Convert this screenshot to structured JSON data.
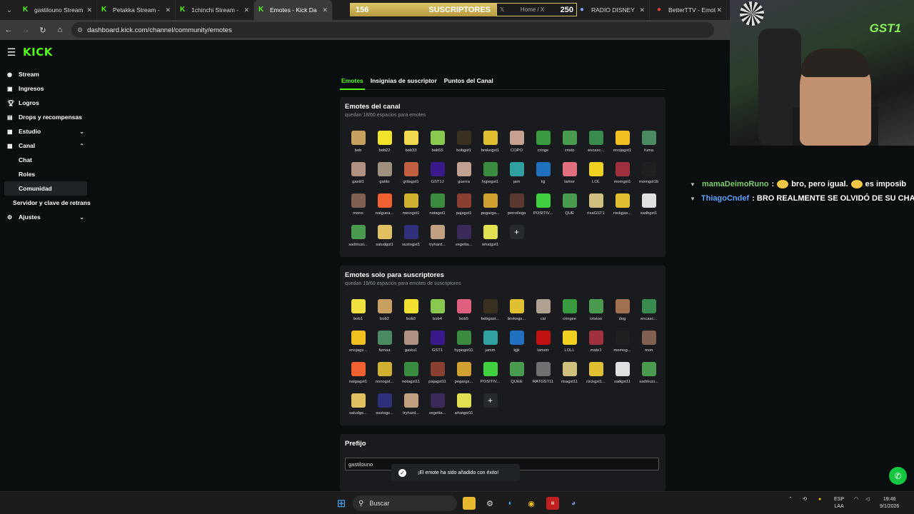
{
  "browser": {
    "tabs": [
      {
        "title": "gastilouno Stream",
        "icon": "kick-icon",
        "active": false
      },
      {
        "title": "Petakka Stream -",
        "icon": "kick-icon",
        "active": false
      },
      {
        "title": "1chinchi Stream -",
        "icon": "kick-icon",
        "active": false
      },
      {
        "title": "Emotes - Kick Da",
        "icon": "kick-icon",
        "active": true
      }
    ],
    "right_tabs": [
      {
        "title": "RADIO DISNEY",
        "icon": "radio-icon"
      },
      {
        "title": "BetterTTV - Emot",
        "icon": "bttv-icon"
      }
    ],
    "url": "dashboard.kick.com/channel/community/emotes"
  },
  "overlay_bar": {
    "left_count": "156",
    "label": "SUSCRIPTORES",
    "home_label": "Home / X",
    "right_count": "250"
  },
  "header": {
    "logo": "KICK"
  },
  "sidebar": {
    "items": [
      {
        "label": "Stream",
        "icon": "broadcast-icon"
      },
      {
        "label": "Ingresos",
        "icon": "wallet-icon"
      },
      {
        "label": "Logros",
        "icon": "trophy-icon"
      },
      {
        "label": "Drops y recompensas",
        "icon": "gift-icon"
      },
      {
        "label": "Estudio",
        "icon": "studio-icon"
      },
      {
        "label": "Canal",
        "icon": "channel-icon"
      },
      {
        "label": "Chat"
      },
      {
        "label": "Roles"
      },
      {
        "label": "Comunidad"
      },
      {
        "label": "Servidor y clave de retrans"
      },
      {
        "label": "Ajustes",
        "icon": "gear-icon"
      }
    ]
  },
  "main_tabs": [
    "Emotes",
    "Insignias de suscriptor",
    "Puntos del Canal"
  ],
  "channel_emotes": {
    "title": "Emotes del canal",
    "subtitle": "quedan 18/60 espacios para emotes",
    "emotes": [
      {
        "name": "bob",
        "color": "#c8a060"
      },
      {
        "name": "bob22",
        "color": "#f2e22a"
      },
      {
        "name": "bob33",
        "color": "#f0d850"
      },
      {
        "name": "bob55",
        "color": "#8ac850"
      },
      {
        "name": "bobgst1",
        "color": "#3a3020"
      },
      {
        "name": "brokegst1",
        "color": "#e0c030"
      },
      {
        "name": "COPO",
        "color": "#c8a090"
      },
      {
        "name": "cringe",
        "color": "#3a9a40"
      },
      {
        "name": "cristo",
        "color": "#4a9a50"
      },
      {
        "name": "encasc...",
        "color": "#3a8a50"
      },
      {
        "name": "enojagst1",
        "color": "#f0c020"
      },
      {
        "name": "fuma",
        "color": "#4a8a60"
      },
      {
        "name": "gastil1",
        "color": "#b09080"
      },
      {
        "name": "gatito",
        "color": "#a09080"
      },
      {
        "name": "gritagst1",
        "color": "#c06040"
      },
      {
        "name": "GST1J",
        "color": "#3a1a8a"
      },
      {
        "name": "guerra",
        "color": "#c0a090"
      },
      {
        "name": "hypegst1",
        "color": "#3a8a40"
      },
      {
        "name": "jam",
        "color": "#30a0a0"
      },
      {
        "name": "kjj",
        "color": "#2070c0"
      },
      {
        "name": "lamer",
        "color": "#e07080"
      },
      {
        "name": "LOL",
        "color": "#f0d020"
      },
      {
        "name": "momgst1",
        "color": "#a03040"
      },
      {
        "name": "momgst1b",
        "color": "#202020"
      },
      {
        "name": "mono",
        "color": "#806050"
      },
      {
        "name": "nalguea...",
        "color": "#f06030"
      },
      {
        "name": "nonogst1",
        "color": "#d0b030"
      },
      {
        "name": "notagst1",
        "color": "#3a8a40"
      },
      {
        "name": "pajagst1",
        "color": "#8a4030"
      },
      {
        "name": "pegarga...",
        "color": "#d0a030"
      },
      {
        "name": "perrollega",
        "color": "#5a3a30"
      },
      {
        "name": "POSITIV...",
        "color": "#40d040"
      },
      {
        "name": "QUE",
        "color": "#4a9a50"
      },
      {
        "name": "risaGST1",
        "color": "#d0c080"
      },
      {
        "name": "rockgas...",
        "color": "#e0c030"
      },
      {
        "name": "sadhgst1",
        "color": "#e0e0e0"
      },
      {
        "name": "sadmusi...",
        "color": "#4a9a50"
      },
      {
        "name": "saludgst1",
        "color": "#e0c060"
      },
      {
        "name": "sustogst1",
        "color": "#30307a"
      },
      {
        "name": "tryhard...",
        "color": "#c0a080"
      },
      {
        "name": "vegetta...",
        "color": "#3a2a5a"
      },
      {
        "name": "whatgst1",
        "color": "#e0e050"
      }
    ]
  },
  "sub_emotes": {
    "title": "Emotes solo para suscriptores",
    "subtitle": "quedan 19/60 espacios para emotes de suscriptores",
    "emotes": [
      {
        "name": "bob1",
        "color": "#f0e040"
      },
      {
        "name": "bob2",
        "color": "#c8a060"
      },
      {
        "name": "bob3",
        "color": "#f0e030"
      },
      {
        "name": "bob4",
        "color": "#8ac850"
      },
      {
        "name": "bob5",
        "color": "#e06080"
      },
      {
        "name": "bobgast...",
        "color": "#3a3020"
      },
      {
        "name": "brokegs...",
        "color": "#e0c030"
      },
      {
        "name": "cat",
        "color": "#b0a090"
      },
      {
        "name": "cringee",
        "color": "#3a9a40"
      },
      {
        "name": "cristoo",
        "color": "#4a9a50"
      },
      {
        "name": "dog",
        "color": "#a07050"
      },
      {
        "name": "encasc...",
        "color": "#3a8a50"
      },
      {
        "name": "enojags...",
        "color": "#f0c020"
      },
      {
        "name": "fumaa",
        "color": "#4a8a60"
      },
      {
        "name": "gastu1",
        "color": "#b09080"
      },
      {
        "name": "GST1",
        "color": "#3a1a8a"
      },
      {
        "name": "hypegst11",
        "color": "#3a8a40"
      },
      {
        "name": "jamm",
        "color": "#30a0a0"
      },
      {
        "name": "kjjk",
        "color": "#2070c0"
      },
      {
        "name": "lamerr",
        "color": "#c01010"
      },
      {
        "name": "LOLL",
        "color": "#f0d020"
      },
      {
        "name": "mate1",
        "color": "#a03040"
      },
      {
        "name": "momog...",
        "color": "#202020"
      },
      {
        "name": "mon",
        "color": "#806050"
      },
      {
        "name": "nalgagst1",
        "color": "#f06030"
      },
      {
        "name": "nonogst...",
        "color": "#d0b030"
      },
      {
        "name": "notagst11",
        "color": "#3a8a40"
      },
      {
        "name": "pajagst11",
        "color": "#8a4030"
      },
      {
        "name": "pegargs...",
        "color": "#d0a030"
      },
      {
        "name": "POSITIV...",
        "color": "#40d040"
      },
      {
        "name": "QUEE",
        "color": "#4a9a50"
      },
      {
        "name": "RATGST11",
        "color": "#707070"
      },
      {
        "name": "risagst11",
        "color": "#d0c080"
      },
      {
        "name": "rockgst1...",
        "color": "#e0c030"
      },
      {
        "name": "sadgst11",
        "color": "#e0e0e0"
      },
      {
        "name": "sadmusi...",
        "color": "#4a9a50"
      },
      {
        "name": "saludgs...",
        "color": "#e0c060"
      },
      {
        "name": "sustogs...",
        "color": "#30307a"
      },
      {
        "name": "tryhard...",
        "color": "#c0a080"
      },
      {
        "name": "vegetta...",
        "color": "#3a2a5a"
      },
      {
        "name": "whatgst11",
        "color": "#e0e050"
      }
    ]
  },
  "prefix": {
    "title": "Prefijo",
    "value": "gastilouno"
  },
  "toast": {
    "message": "¡El emote ha sido añadido con éxito!"
  },
  "chat": [
    {
      "user": "mamaDeimoRuno",
      "user_color": "#7cd36c",
      "parts": [
        "bro, pero igual.",
        "es imposib"
      ]
    },
    {
      "user": "ThiagoCndef",
      "user_color": "#5aa6ff",
      "parts": [
        "BRO REALMENTE SE OLVIDÓ DE SU CHAT"
      ]
    }
  ],
  "taskbar": {
    "search_label": "Buscar",
    "lang_top": "ESP",
    "lang_bottom": "LAA",
    "time": "19:46",
    "date": "9/1/2026"
  },
  "colors": {
    "accent": "#53fc18",
    "panel": "#191b1f",
    "bg": "#0b0e0f"
  }
}
